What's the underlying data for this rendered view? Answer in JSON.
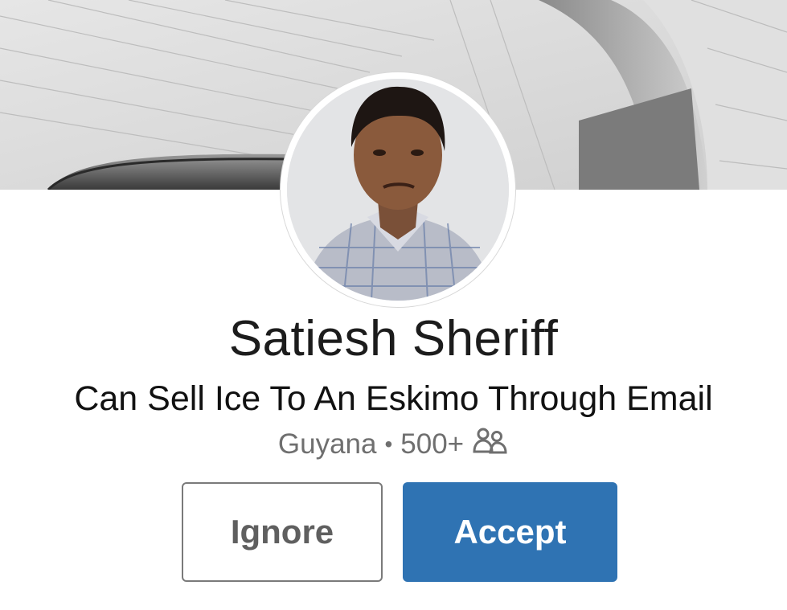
{
  "profile": {
    "name": "Satiesh Sheriff",
    "headline": "Can Sell Ice To An Eskimo Through Email",
    "location": "Guyana",
    "separator": "•",
    "connections": "500+",
    "connections_icon": "connections-icon"
  },
  "actions": {
    "ignore_label": "Ignore",
    "accept_label": "Accept"
  },
  "colors": {
    "accept_bg": "#2f73b3",
    "ignore_border": "#7a7a7a",
    "meta_text": "#6f6f6f"
  }
}
